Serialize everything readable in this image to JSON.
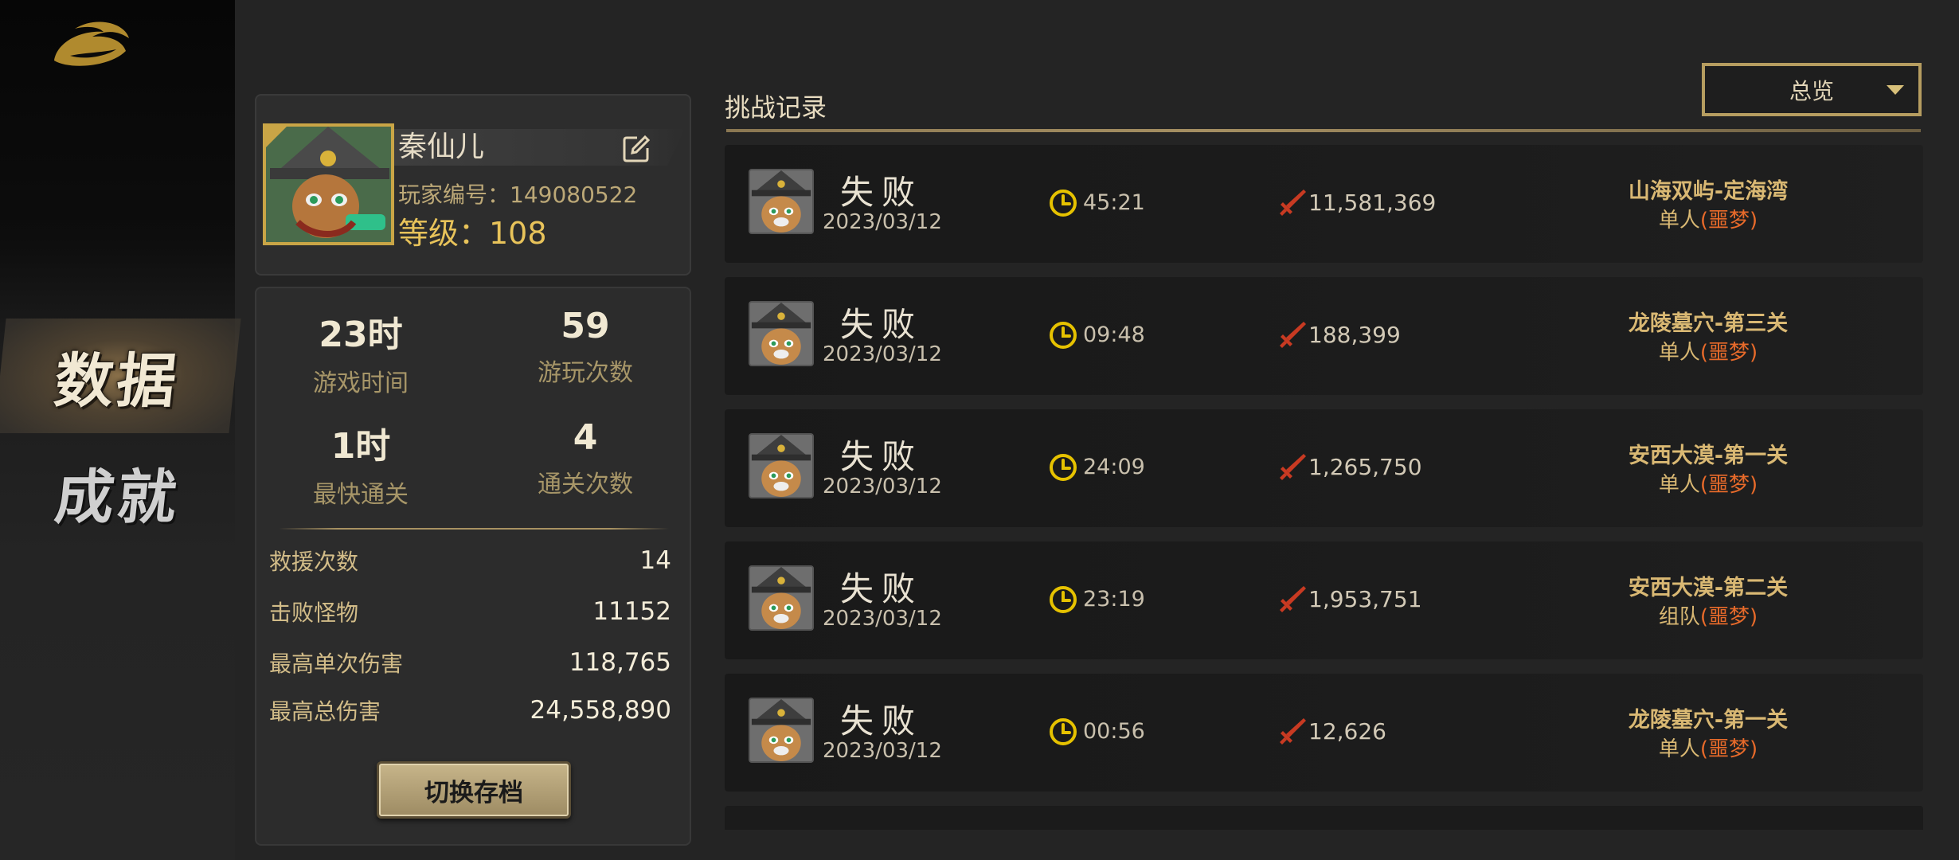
{
  "nav": {
    "items": [
      {
        "label": "数据",
        "active": true
      },
      {
        "label": "成就",
        "active": false
      }
    ]
  },
  "profile": {
    "name": "秦仙儿",
    "id_text": "玩家编号：149080522",
    "level_text": "等级：108"
  },
  "stats": {
    "big": [
      {
        "value": "23时",
        "label": "游戏时间"
      },
      {
        "value": "59",
        "label": "游玩次数"
      },
      {
        "value": "1时",
        "label": "最快通关"
      },
      {
        "value": "4",
        "label": "通关次数"
      }
    ],
    "rows": [
      {
        "label": "救援次数",
        "value": "14"
      },
      {
        "label": "击败怪物",
        "value": "11152"
      },
      {
        "label": "最高单次伤害",
        "value": "118,765"
      },
      {
        "label": "最高总伤害",
        "value": "24,558,890"
      }
    ],
    "switch_button": "切换存档"
  },
  "records": {
    "title": "挑战记录",
    "filter": "总览",
    "items": [
      {
        "result": "失败",
        "date": "2023/03/12",
        "time": "45:21",
        "damage": "11,581,369",
        "stage": "山海双屿-定海湾",
        "mode": "单人",
        "difficulty": "(噩梦)"
      },
      {
        "result": "失败",
        "date": "2023/03/12",
        "time": "09:48",
        "damage": "188,399",
        "stage": "龙陵墓穴-第三关",
        "mode": "单人",
        "difficulty": "(噩梦)"
      },
      {
        "result": "失败",
        "date": "2023/03/12",
        "time": "24:09",
        "damage": "1,265,750",
        "stage": "安西大漠-第一关",
        "mode": "单人",
        "difficulty": "(噩梦)"
      },
      {
        "result": "失败",
        "date": "2023/03/12",
        "time": "23:19",
        "damage": "1,953,751",
        "stage": "安西大漠-第二关",
        "mode": "组队",
        "difficulty": "(噩梦)"
      },
      {
        "result": "失败",
        "date": "2023/03/12",
        "time": "00:56",
        "damage": "12,626",
        "stage": "龙陵墓穴-第一关",
        "mode": "单人",
        "difficulty": "(噩梦)"
      }
    ]
  },
  "colors": {
    "accent_gold": "#c9a546",
    "difficulty_orange": "#e76a2a",
    "clock_yellow": "#e6c200",
    "sword_red": "#c83a22"
  }
}
